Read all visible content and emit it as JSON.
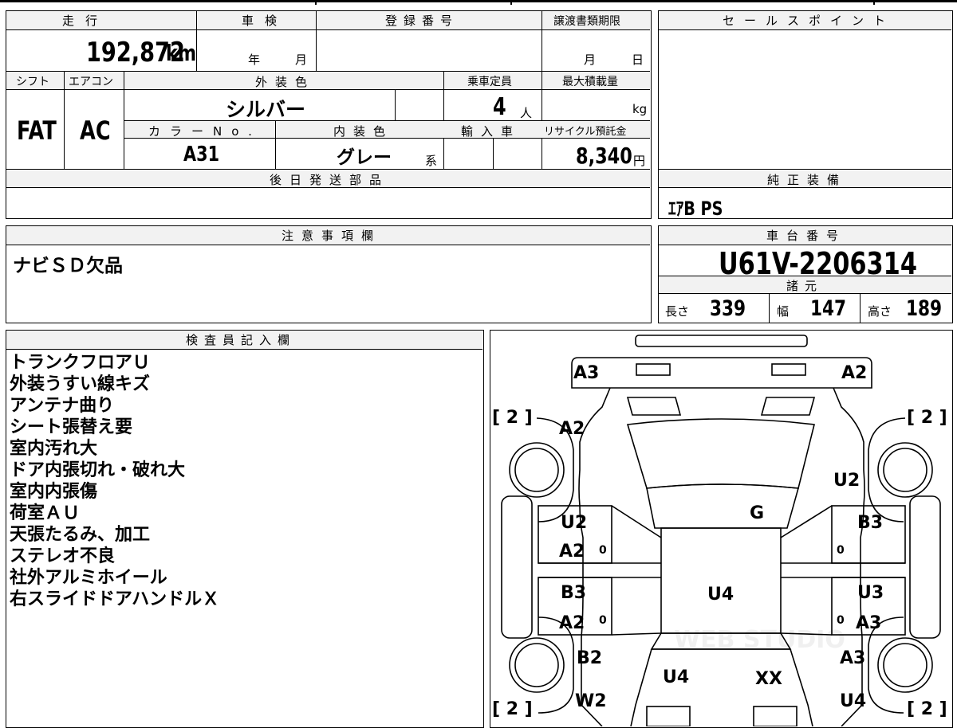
{
  "vehicle": {
    "mileage_label": "走行",
    "mileage_value": "192,872",
    "mileage_unit": "km",
    "inspection_label": "車検",
    "inspection_year_unit": "年",
    "inspection_month_unit": "月",
    "registration_label": "登録番号",
    "transfer_deadline_label": "譲渡書類期限",
    "transfer_month_unit": "月",
    "transfer_day_unit": "日",
    "shift_label": "シフト",
    "shift_value": "FAT",
    "aircon_label": "エアコン",
    "aircon_value": "AC",
    "exterior_color_label": "外装色",
    "exterior_color_value": "シルバー",
    "capacity_label": "乗車定員",
    "capacity_value": "4",
    "capacity_unit": "人",
    "max_load_label": "最大積載量",
    "max_load_unit": "kg",
    "color_no_label": "カラーNo.",
    "color_no_value": "A31",
    "interior_color_label": "内装色",
    "interior_color_value": "グレー",
    "interior_color_suffix": "系",
    "import_label": "輸入車",
    "recycle_label": "リサイクル預託金",
    "recycle_value": "8,340",
    "recycle_unit": "円",
    "later_parts_label": "後日発送部品"
  },
  "sales_point": {
    "label": "セールスポイント"
  },
  "genuine_equipment": {
    "label": "純正装備",
    "value": "ｴｱB PS"
  },
  "caution": {
    "label": "注意事項欄",
    "value": "ナビＳＤ欠品"
  },
  "chassis": {
    "label": "車台番号",
    "value": "U61V-2206314",
    "spec_label": "諸元",
    "length_label": "長さ",
    "length_value": "339",
    "width_label": "幅",
    "width_value": "147",
    "height_label": "高さ",
    "height_value": "189"
  },
  "inspector": {
    "label": "検査員記入欄",
    "notes": [
      "トランクフロアＵ",
      "外装うすい線キズ",
      "アンテナ曲り",
      "シート張替え要",
      "室内汚れ大",
      "ドア内張切れ・破れ大",
      "室内内張傷",
      "荷室ＡＵ",
      "天張たるみ、加工",
      "ステレオ不良",
      "社外アルミホイール",
      "右スライドドアハンドルＸ"
    ]
  },
  "diagram": {
    "tire_top_left": "[ 2 ]",
    "tire_top_right": "[ 2 ]",
    "tire_bottom_left": "[ 2 ]",
    "tire_bottom_right": "[ 2 ]",
    "marks": {
      "rear_left": "A3",
      "rear_right": "A2",
      "rear_quarter_left": "A2",
      "rear_quarter_right": "U2",
      "rear_glass": "G",
      "slide_door_left_1": "U2",
      "slide_door_left_2": "A2",
      "slide_door_right_1": "B3",
      "roof": "U4",
      "front_door_left_1": "B3",
      "front_door_left_2": "A2",
      "front_door_right_1": "U3",
      "front_door_right_2": "A3",
      "front_fender_left": "B2",
      "front_fender_right": "A3",
      "hood_left": "U4",
      "hood_right": "XX",
      "front_bumper_left": "W2",
      "front_bumper_right": "U4"
    },
    "small_marks": {
      "l1": "0",
      "r1": "0",
      "l2": "0",
      "r2": "0"
    },
    "watermark": "WEB STUDIO"
  }
}
